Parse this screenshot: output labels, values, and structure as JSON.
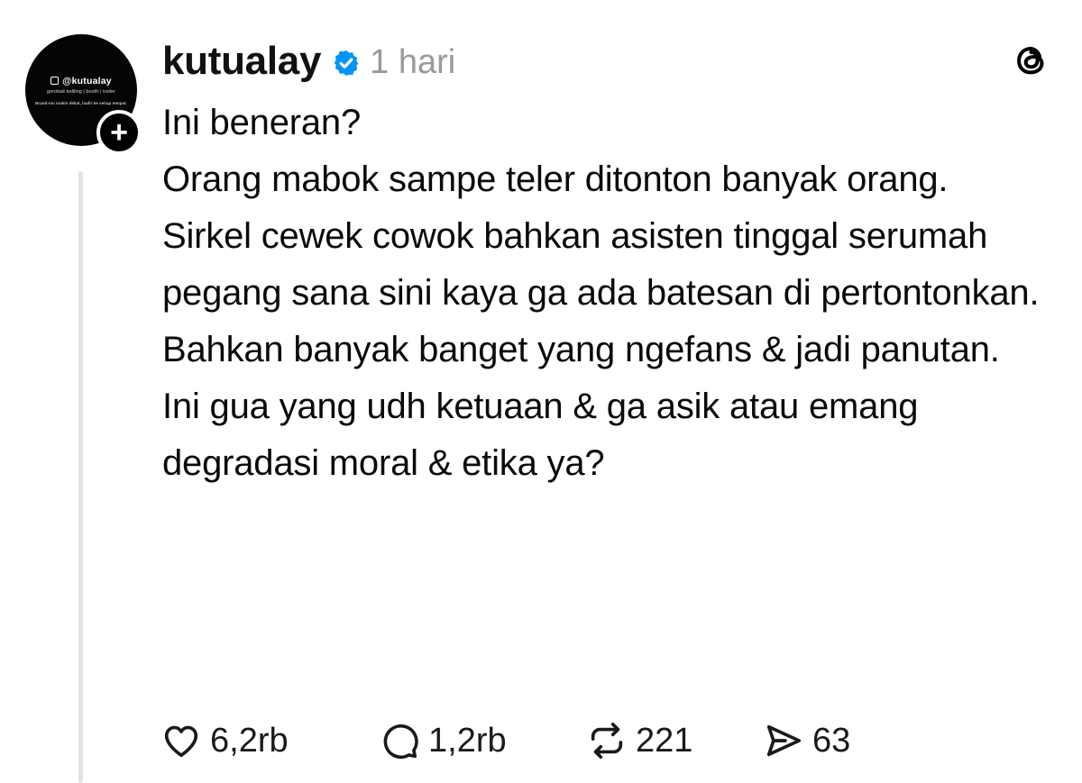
{
  "avatar": {
    "handle": "@kutualay",
    "subtitle": "gerobak keliling | booth | trailer",
    "tagline": "Brand-mu makin dekat, hadir ke setiap tempat."
  },
  "post": {
    "username": "kutualay",
    "time": "1 hari",
    "lines": [
      "Ini beneran?",
      "Orang mabok sampe teler ditonton banyak orang.",
      "Sirkel cewek cowok bahkan asisten tinggal serumah pegang sana sini kaya ga ada batesan di pertontonkan.",
      "Bahkan banyak banget yang ngefans & jadi panutan.",
      "Ini gua yang udh ketuaan & ga asik atau emang degradasi moral & etika ya?"
    ],
    "likes": "6,2rb",
    "replies": "1,2rb",
    "reposts": "221",
    "shares": "63"
  },
  "colors": {
    "verified": "#0095f6",
    "muted_text": "#9a9a9a",
    "thread_line": "#e3e3e3"
  },
  "icons": {
    "verified": "verified-badge-icon",
    "app": "threads-logo-icon",
    "follow": "plus-icon",
    "like": "heart-icon",
    "reply": "speech-bubble-icon",
    "repost": "repost-icon",
    "share": "send-icon"
  }
}
